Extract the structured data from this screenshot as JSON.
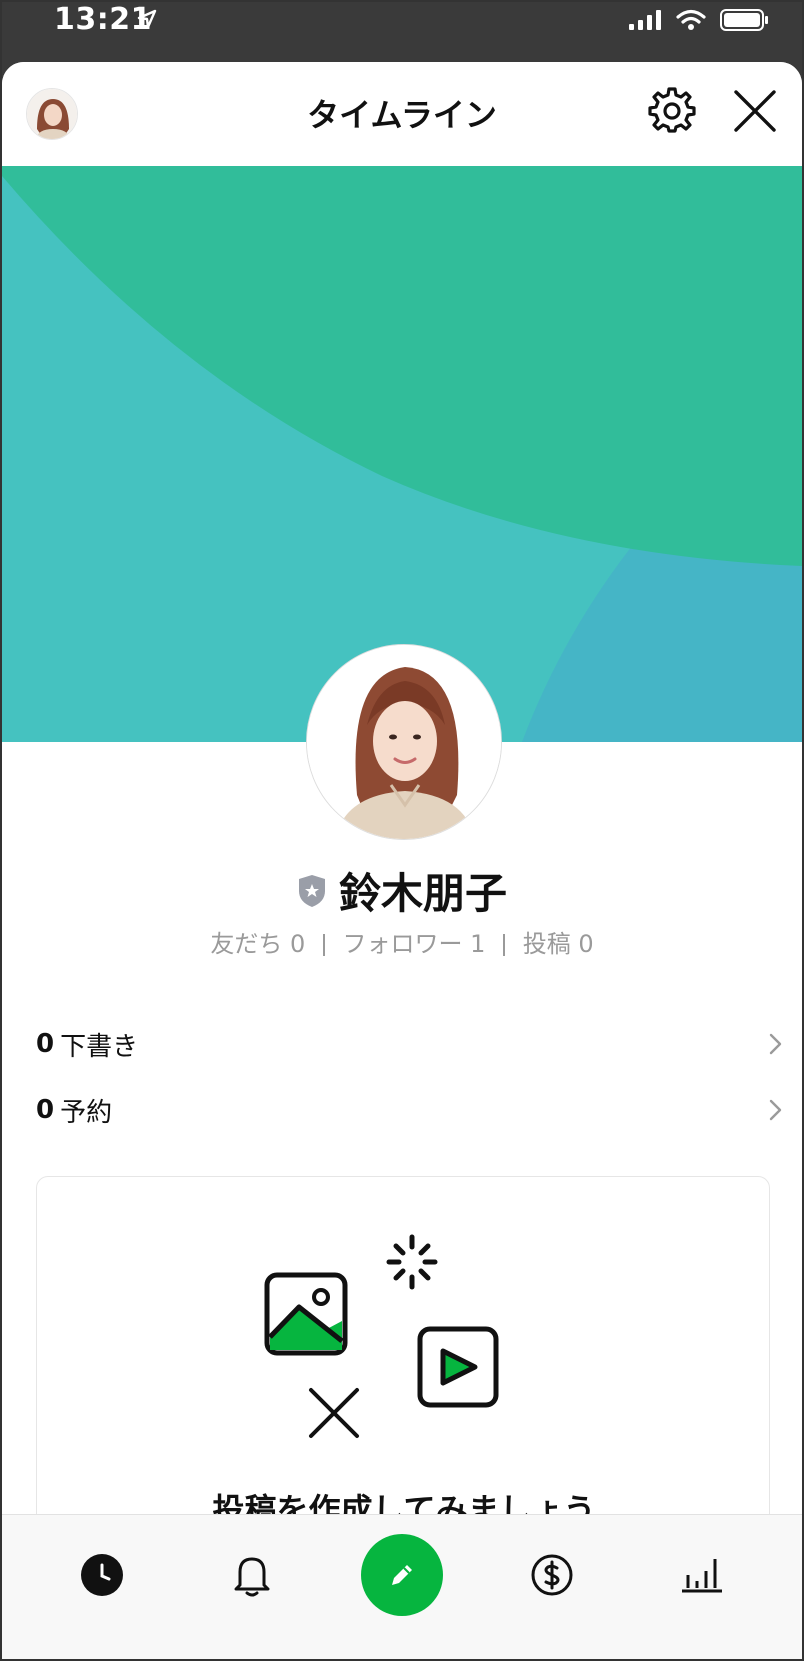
{
  "status_bar": {
    "time": "13:21",
    "icons": [
      "location-arrow-icon",
      "signal-icon",
      "wifi-icon",
      "battery-icon"
    ]
  },
  "nav": {
    "title": "タイムライン",
    "icons": [
      "avatar",
      "gear-icon",
      "close-icon"
    ]
  },
  "profile": {
    "name": "鈴木朋子",
    "stats": [
      {
        "label": "友だち",
        "value": "0"
      },
      {
        "label": "フォロワー",
        "value": "1"
      },
      {
        "label": "投稿",
        "value": "0"
      }
    ]
  },
  "rows": {
    "draft": {
      "count": "0",
      "label": "下書き"
    },
    "scheduled": {
      "count": "0",
      "label": "予約"
    }
  },
  "empty_state": {
    "title": "投稿を作成してみましょう"
  },
  "tabbar": {
    "items": [
      "clock-icon",
      "bell-icon",
      "pencil-icon",
      "dollar-icon",
      "bar-chart-icon"
    ]
  },
  "colors": {
    "cover_green": "#31BD9A",
    "cover_teal": "#45C2C0",
    "cover_blue": "#45B5C6",
    "accent_green": "#06B53F",
    "stat_gray": "#9A9A9A"
  }
}
